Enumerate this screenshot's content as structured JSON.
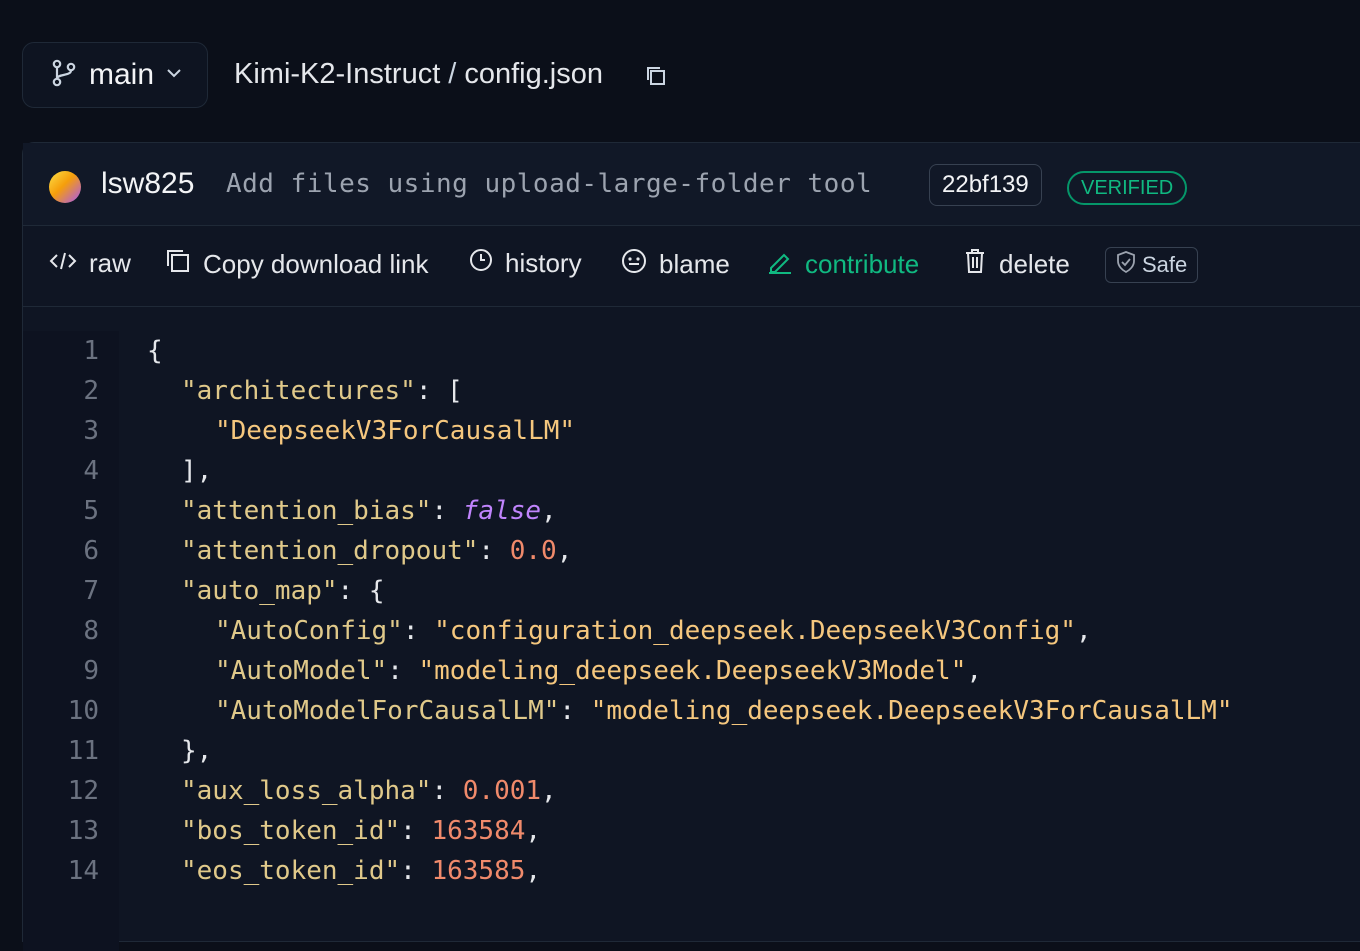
{
  "header": {
    "branch": "main",
    "repo": "Kimi-K2-Instruct",
    "separator": "/",
    "file": "config.json"
  },
  "commit": {
    "author": "lsw825",
    "message": "Add files using upload-large-folder tool",
    "hash": "22bf139",
    "badge": "VERIFIED"
  },
  "toolbar": {
    "raw": "raw",
    "copy_link": "Copy download link",
    "history": "history",
    "blame": "blame",
    "contribute": "contribute",
    "delete": "delete",
    "safe": "Safe"
  },
  "colors": {
    "accent_green": "#10b981",
    "key": "#e0c98a",
    "string": "#f5c77e",
    "number": "#f08a6b",
    "boolean": "#c084fc"
  },
  "code_lines": [
    {
      "n": "1",
      "tokens": [
        {
          "t": "{",
          "c": "p"
        }
      ],
      "indent": 0
    },
    {
      "n": "2",
      "tokens": [
        {
          "t": "\"architectures\"",
          "c": "k"
        },
        {
          "t": ": [",
          "c": "p"
        }
      ],
      "indent": 1
    },
    {
      "n": "3",
      "tokens": [
        {
          "t": "\"DeepseekV3ForCausalLM\"",
          "c": "s"
        }
      ],
      "indent": 2
    },
    {
      "n": "4",
      "tokens": [
        {
          "t": "],",
          "c": "p"
        }
      ],
      "indent": 1
    },
    {
      "n": "5",
      "tokens": [
        {
          "t": "\"attention_bias\"",
          "c": "k"
        },
        {
          "t": ": ",
          "c": "p"
        },
        {
          "t": "false",
          "c": "b"
        },
        {
          "t": ",",
          "c": "p"
        }
      ],
      "indent": 1
    },
    {
      "n": "6",
      "tokens": [
        {
          "t": "\"attention_dropout\"",
          "c": "k"
        },
        {
          "t": ": ",
          "c": "p"
        },
        {
          "t": "0.0",
          "c": "n"
        },
        {
          "t": ",",
          "c": "p"
        }
      ],
      "indent": 1
    },
    {
      "n": "7",
      "tokens": [
        {
          "t": "\"auto_map\"",
          "c": "k"
        },
        {
          "t": ": {",
          "c": "p"
        }
      ],
      "indent": 1
    },
    {
      "n": "8",
      "tokens": [
        {
          "t": "\"AutoConfig\"",
          "c": "k"
        },
        {
          "t": ": ",
          "c": "p"
        },
        {
          "t": "\"configuration_deepseek.DeepseekV3Config\"",
          "c": "s"
        },
        {
          "t": ",",
          "c": "p"
        }
      ],
      "indent": 2
    },
    {
      "n": "9",
      "tokens": [
        {
          "t": "\"AutoModel\"",
          "c": "k"
        },
        {
          "t": ": ",
          "c": "p"
        },
        {
          "t": "\"modeling_deepseek.DeepseekV3Model\"",
          "c": "s"
        },
        {
          "t": ",",
          "c": "p"
        }
      ],
      "indent": 2
    },
    {
      "n": "10",
      "tokens": [
        {
          "t": "\"AutoModelForCausalLM\"",
          "c": "k"
        },
        {
          "t": ": ",
          "c": "p"
        },
        {
          "t": "\"modeling_deepseek.DeepseekV3ForCausalLM\"",
          "c": "s"
        }
      ],
      "indent": 2
    },
    {
      "n": "11",
      "tokens": [
        {
          "t": "},",
          "c": "p"
        }
      ],
      "indent": 1
    },
    {
      "n": "12",
      "tokens": [
        {
          "t": "\"aux_loss_alpha\"",
          "c": "k"
        },
        {
          "t": ": ",
          "c": "p"
        },
        {
          "t": "0.001",
          "c": "n"
        },
        {
          "t": ",",
          "c": "p"
        }
      ],
      "indent": 1
    },
    {
      "n": "13",
      "tokens": [
        {
          "t": "\"bos_token_id\"",
          "c": "k"
        },
        {
          "t": ": ",
          "c": "p"
        },
        {
          "t": "163584",
          "c": "n"
        },
        {
          "t": ",",
          "c": "p"
        }
      ],
      "indent": 1
    },
    {
      "n": "14",
      "tokens": [
        {
          "t": "\"eos_token_id\"",
          "c": "k"
        },
        {
          "t": ": ",
          "c": "p"
        },
        {
          "t": "163585",
          "c": "n"
        },
        {
          "t": ",",
          "c": "p"
        }
      ],
      "indent": 1
    }
  ]
}
